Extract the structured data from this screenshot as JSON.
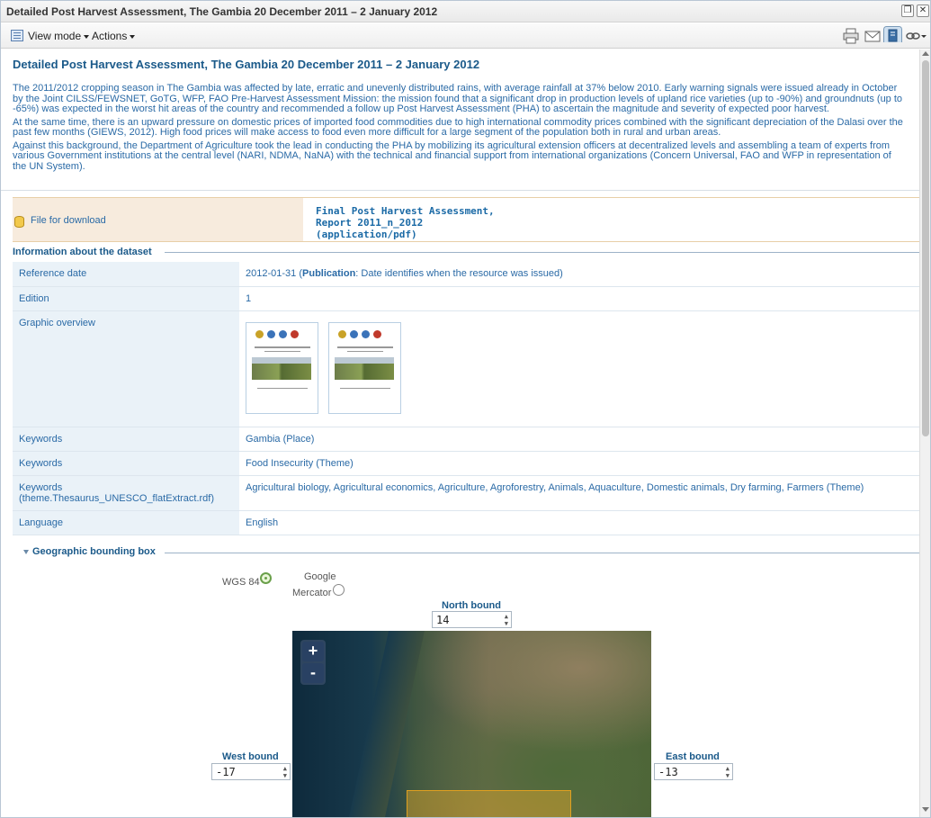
{
  "window": {
    "title": "Detailed Post Harvest Assessment, The Gambia 20 December 2011 – 2 January 2012"
  },
  "toolbar": {
    "view_mode_label": "View mode",
    "actions_label": "Actions",
    "tools": [
      "print-icon",
      "email-icon",
      "bookmark-icon",
      "link-icon"
    ]
  },
  "record": {
    "title": "Detailed Post Harvest Assessment, The Gambia 20 December 2011 – 2 January 2012",
    "abstract": [
      "The 2011/2012 cropping season in The Gambia was affected by late, erratic and unevenly distributed rains, with average rainfall at 37% below 2010. Early warning signals were issued already in October by the Joint CILSS/FEWSNET, GoTG, WFP, FAO Pre-Harvest Assessment Mission: the mission found that a significant drop in production levels of upland rice varieties (up to -90%) and groundnuts (up to -65%) was expected in the worst hit areas of the country and recommended a follow up Post Harvest Assessment (PHA) to ascertain the magnitude and severity of expected poor harvest.",
      "At the same time, there is an upward pressure on domestic prices of imported food commodities due to high international commodity prices combined with the significant depreciation of the Dalasi over the past few months (GIEWS, 2012). High food prices will make access to food even more difficult for a large segment of the population both in rural and urban areas.",
      "Against this background, the Department of Agriculture took the lead in conducting the PHA by mobilizing its agricultural extension officers at decentralized levels and assembling a team of experts from various Government institutions at the central level (NARI, NDMA, NaNA) with the technical and financial support from international organizations (Concern Universal, FAO and WFP in representation of the UN System)."
    ]
  },
  "download": {
    "label": "File for download",
    "link_line1": "Final Post Harvest Assessment,",
    "link_line2": "Report 2011_n_2012",
    "link_line3": "(application/pdf)"
  },
  "dataset": {
    "section_title": "Information about the dataset",
    "reference_date_key": "Reference date",
    "reference_date_value": "2012-01-31",
    "reference_date_paren_open": " (",
    "reference_date_type": "Publication",
    "reference_date_desc": ": Date identifies when the resource was issued)",
    "edition_key": "Edition",
    "edition_value": "1",
    "graphic_key": "Graphic overview",
    "keywords1_key": "Keywords",
    "keywords1_value": "Gambia (Place)",
    "keywords2_key": "Keywords",
    "keywords2_value": "Food Insecurity (Theme)",
    "keywords3_key_line1": "Keywords",
    "keywords3_key_line2": "(theme.Thesaurus_UNESCO_flatExtract.rdf)",
    "keywords3_value": "Agricultural biology, Agricultural economics, Agriculture, Agroforestry, Animals, Aquaculture, Domestic animals, Dry farming, Farmers (Theme)",
    "language_key": "Language",
    "language_value": "English"
  },
  "geo": {
    "section_title": "Geographic bounding box",
    "projection_wgs84": "WGS 84",
    "projection_google_line1": "Google",
    "projection_google_line2": "Mercator",
    "north_label": "North bound",
    "north_value": "14",
    "west_label": "West bound",
    "west_value": "-17",
    "east_label": "East bound",
    "east_value": "-13",
    "zoom_in": "+",
    "zoom_out": "-"
  }
}
